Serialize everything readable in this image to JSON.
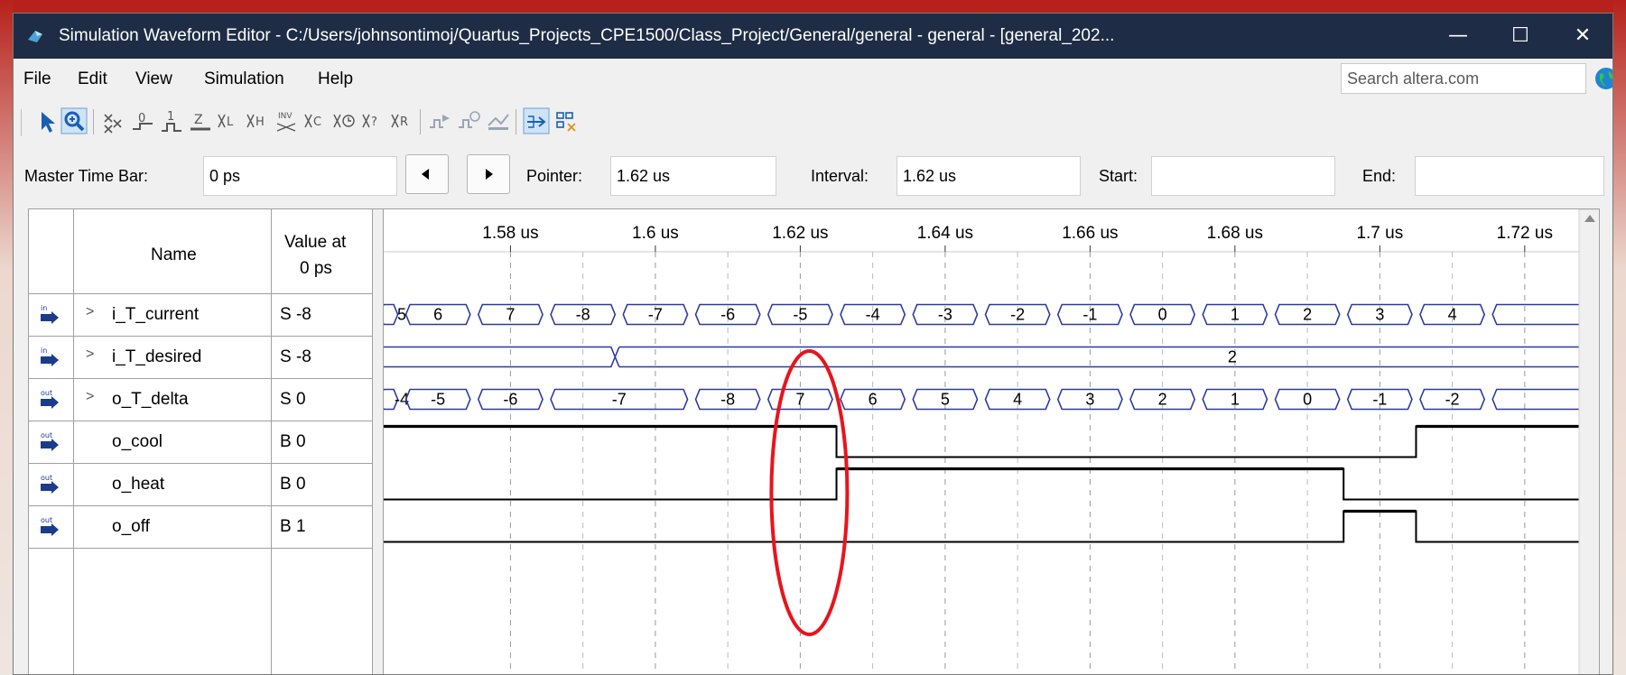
{
  "window": {
    "title": "Simulation Waveform Editor - C:/Users/johnsontimoj/Quartus_Projects_CPE1500/Class_Project/General/general - general - [general_202...",
    "min_glyph": "—",
    "max_glyph": "☐",
    "close_glyph": "✕"
  },
  "menu": [
    "File",
    "Edit",
    "View",
    "Simulation",
    "Help"
  ],
  "search": {
    "placeholder": "Search altera.com"
  },
  "timebar": {
    "master_label": "Master Time Bar:",
    "master_value": "0 ps",
    "pointer_label": "Pointer:",
    "pointer_value": "1.62 us",
    "interval_label": "Interval:",
    "interval_value": "1.62 us",
    "start_label": "Start:",
    "start_value": "",
    "end_label": "End:",
    "end_value": ""
  },
  "table": {
    "name_header": "Name",
    "value_header_line1": "Value at",
    "value_header_line2": "0 ps",
    "signals": [
      {
        "name": "i_T_current",
        "value": "S -8",
        "dir": "in",
        "bus": true
      },
      {
        "name": "i_T_desired",
        "value": "S -8",
        "dir": "in",
        "bus": true
      },
      {
        "name": "o_T_delta",
        "value": "S 0",
        "dir": "out",
        "bus": true
      },
      {
        "name": "o_cool",
        "value": "B 0",
        "dir": "out",
        "bus": false
      },
      {
        "name": "o_heat",
        "value": "B 0",
        "dir": "out",
        "bus": false
      },
      {
        "name": "o_off",
        "value": "B 1",
        "dir": "out",
        "bus": false
      }
    ]
  },
  "timeline": {
    "ticks": [
      "1.58 us",
      "1.6 us",
      "1.62 us",
      "1.64 us",
      "1.66 us",
      "1.68 us",
      "1.7 us",
      "1.72 us"
    ],
    "range_us": [
      1.5625,
      1.7275
    ],
    "tick_step_us": 0.02,
    "first_tick_us": 1.58,
    "bus_transition_step_us": 0.01,
    "first_bus_transition_us": 1.565
  },
  "waves": {
    "i_T_current": {
      "transitions_us": [
        1.565,
        1.575,
        1.585,
        1.595,
        1.605,
        1.615,
        1.625,
        1.635,
        1.645,
        1.655,
        1.665,
        1.675,
        1.685,
        1.695,
        1.705,
        1.715
      ],
      "values": [
        "5",
        "6",
        "7",
        "-8",
        "-7",
        "-6",
        "-5",
        "-4",
        "-3",
        "-2",
        "-1",
        "0",
        "1",
        "2",
        "3",
        "4"
      ]
    },
    "i_T_desired": {
      "transitions_us": [
        1.595
      ],
      "values": [
        "",
        "2"
      ]
    },
    "o_T_delta": {
      "transitions_us": [
        1.565,
        1.575,
        1.585,
        1.605,
        1.615,
        1.625,
        1.635,
        1.645,
        1.655,
        1.665,
        1.675,
        1.685,
        1.695,
        1.705,
        1.715
      ],
      "values": [
        "-4",
        "-5",
        "-6",
        "-7",
        "-8",
        "7",
        "6",
        "5",
        "4",
        "3",
        "2",
        "1",
        "0",
        "-1",
        "-2"
      ]
    },
    "o_cool": {
      "levels": [
        1,
        0,
        1
      ],
      "edges_us": [
        1.625,
        1.705
      ]
    },
    "o_heat": {
      "levels": [
        0,
        1,
        0
      ],
      "edges_us": [
        1.625,
        1.695
      ]
    },
    "o_off": {
      "levels": [
        0,
        1,
        0
      ],
      "edges_us": [
        1.695,
        1.705
      ]
    }
  },
  "colors": {
    "titlebar": "#1e2c45",
    "bus": "#2a3aa0",
    "annotation": "#e8141c",
    "background_top": "#b7211b"
  },
  "icons": [
    "arrow-select-icon",
    "zoom-icon",
    "uninitialized-icon",
    "forcing-low-icon",
    "forcing-high-icon",
    "high-impedance-icon",
    "weak-low-icon",
    "weak-high-icon",
    "invert-icon",
    "count-value-icon",
    "clock-icon",
    "random-value-icon",
    "arbitrary-value-icon",
    "run-functional-icon",
    "run-timing-icon",
    "simulation-report-icon",
    "snap-to-grid-icon",
    "sort-icon"
  ]
}
